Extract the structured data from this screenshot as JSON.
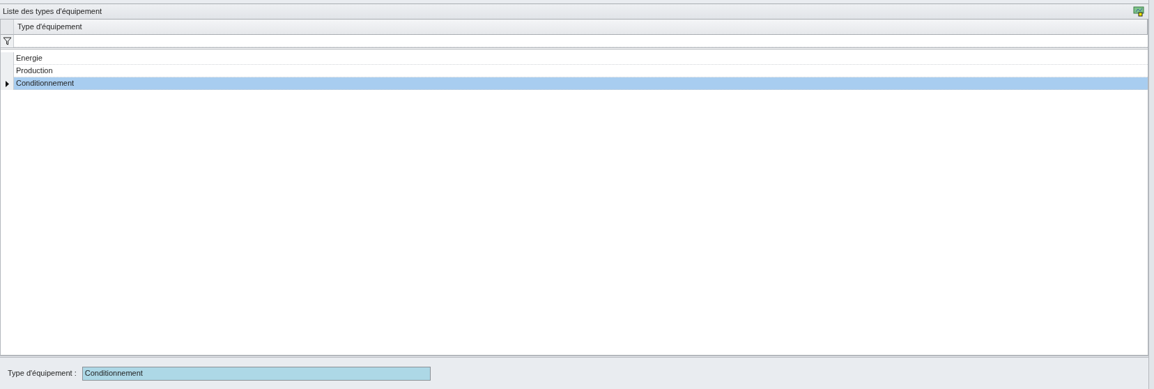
{
  "panel": {
    "title": "Liste des types d'équipement"
  },
  "grid": {
    "columns": [
      "Type d'équipement"
    ],
    "rows": [
      {
        "cells": [
          "Energie"
        ],
        "selected": false
      },
      {
        "cells": [
          "Production"
        ],
        "selected": false
      },
      {
        "cells": [
          "Conditionnement"
        ],
        "selected": true
      }
    ]
  },
  "detail": {
    "label": "Type d'équipement :",
    "value": "Conditionnement"
  }
}
